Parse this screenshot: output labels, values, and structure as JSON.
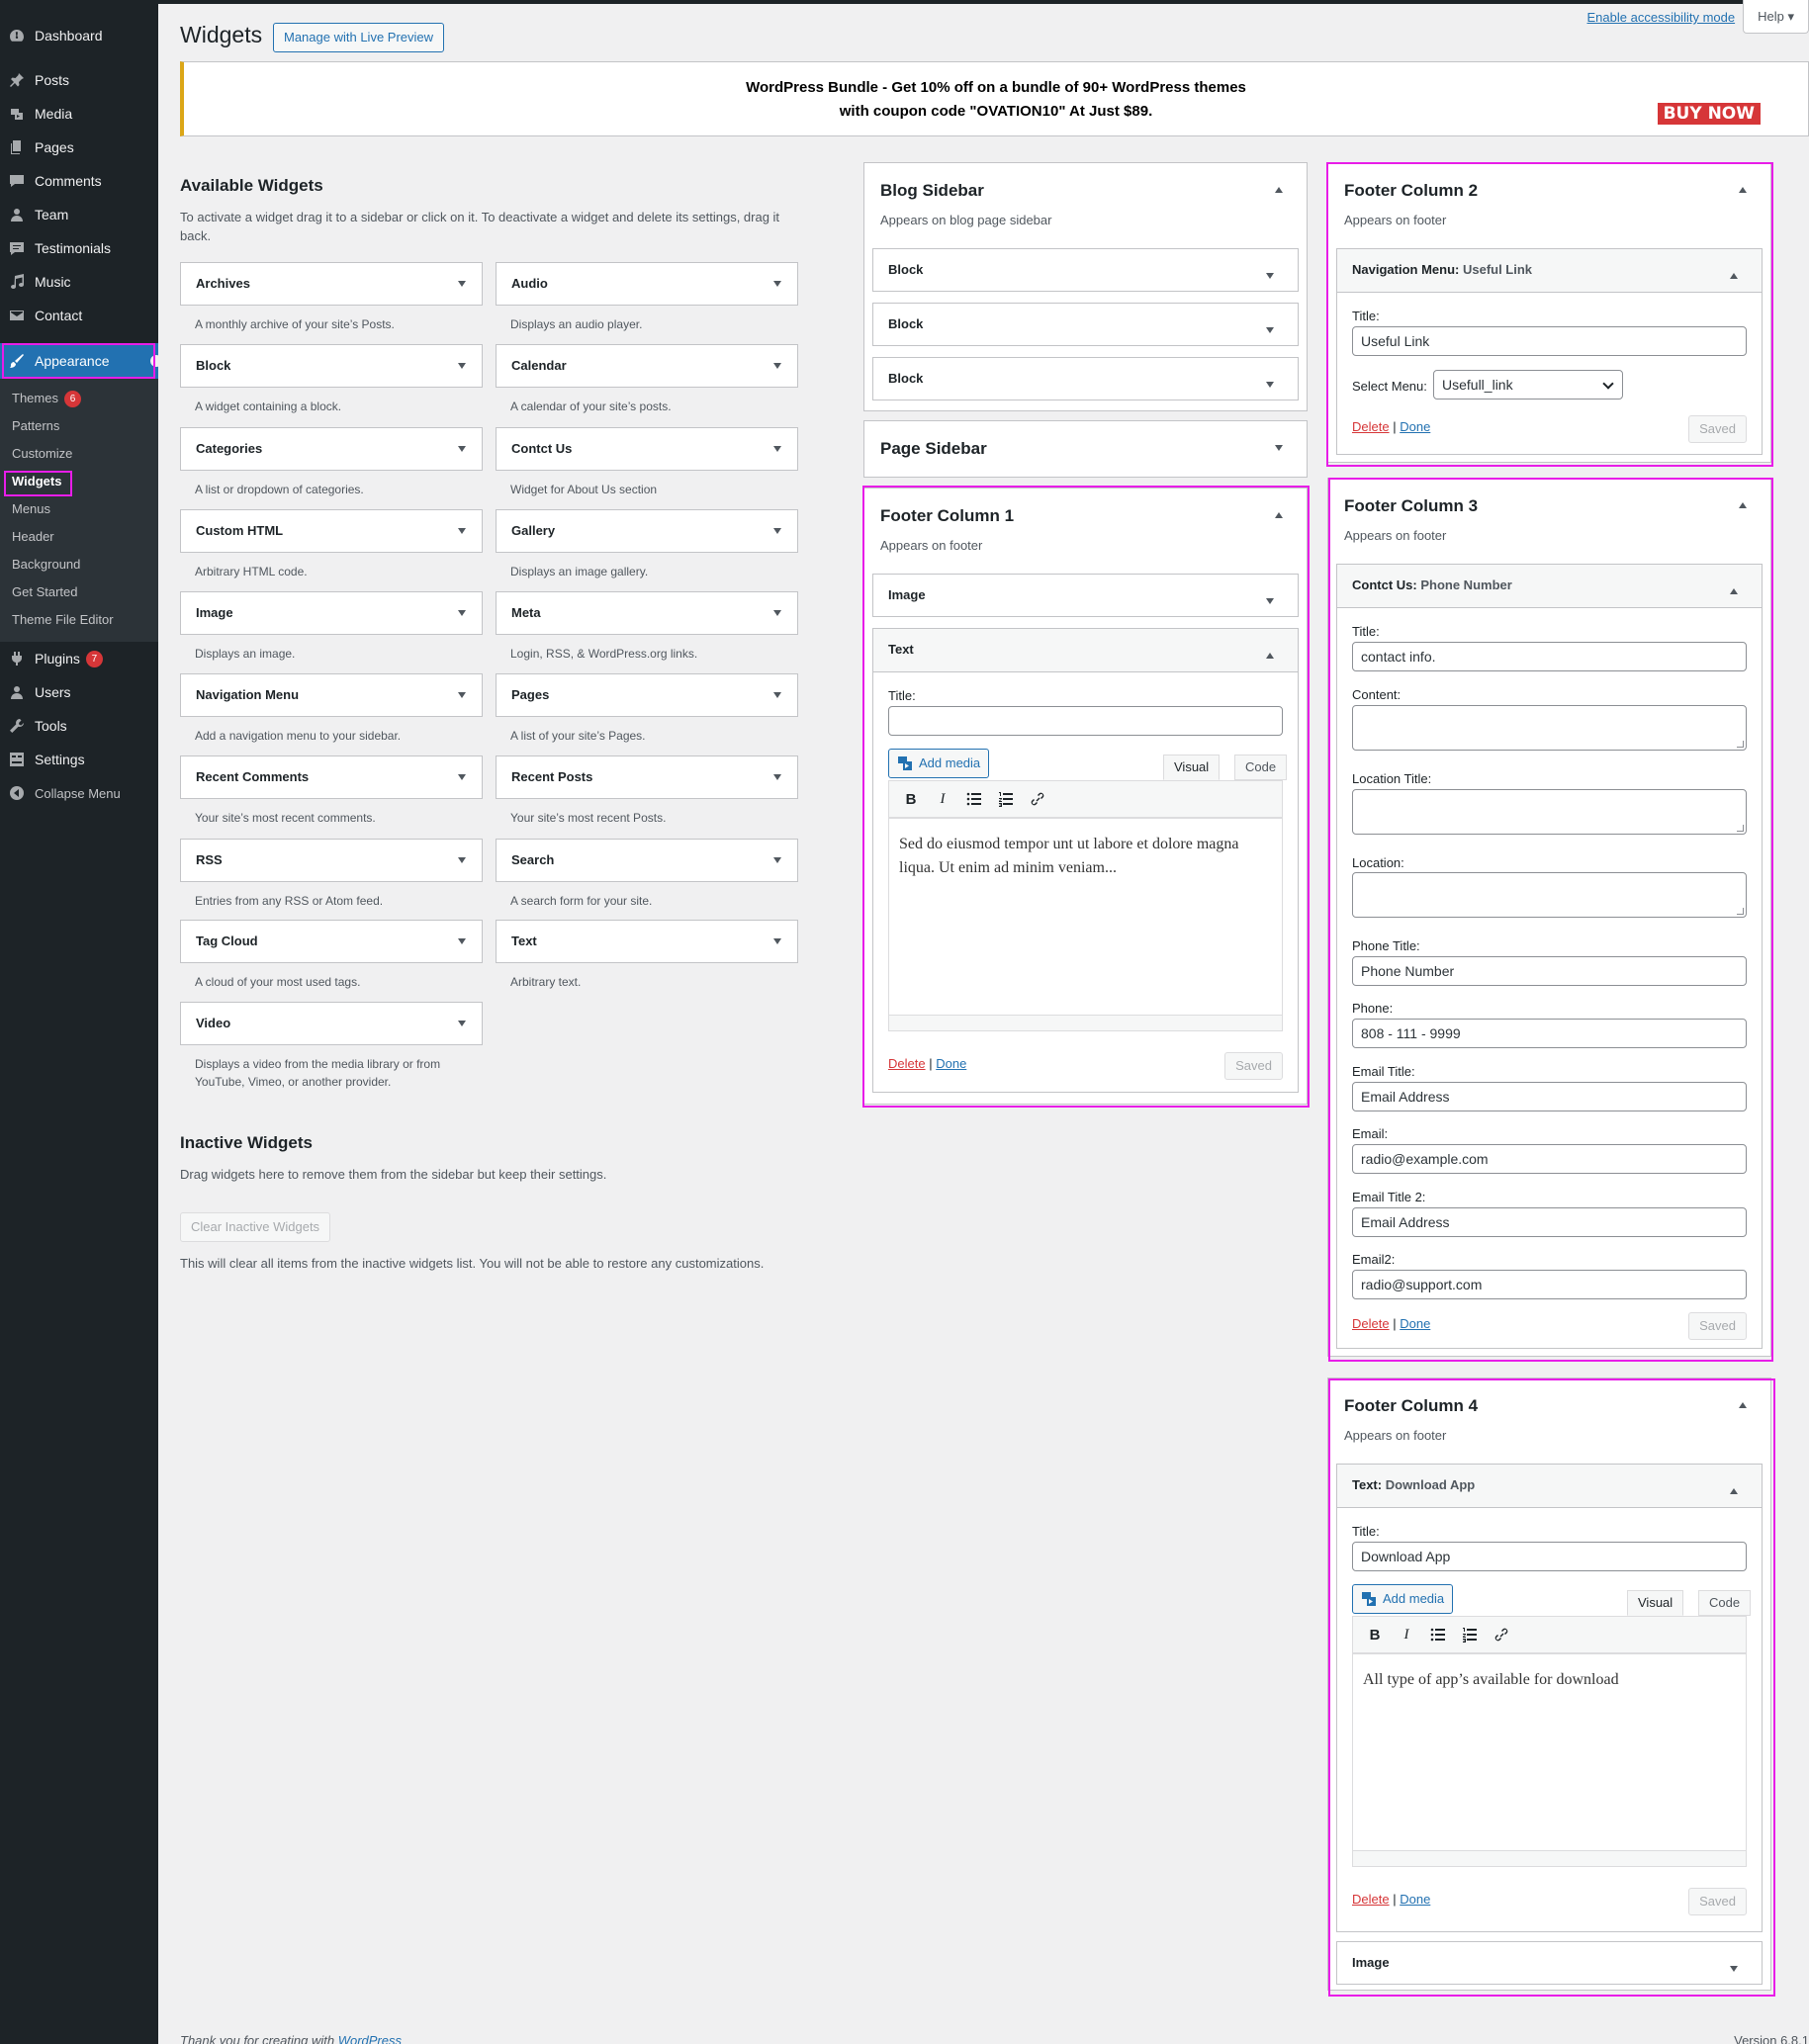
{
  "sidebar": {
    "items": [
      {
        "label": "Dashboard",
        "icon": "dashboard-icon"
      },
      {
        "label": "Posts",
        "icon": "pin-icon"
      },
      {
        "label": "Media",
        "icon": "media-icon"
      },
      {
        "label": "Pages",
        "icon": "pages-icon"
      },
      {
        "label": "Comments",
        "icon": "comment-icon"
      },
      {
        "label": "Team",
        "icon": "person-icon"
      },
      {
        "label": "Testimonials",
        "icon": "testimonial-icon"
      },
      {
        "label": "Music",
        "icon": "music-icon"
      },
      {
        "label": "Contact",
        "icon": "mail-icon"
      },
      {
        "label": "Appearance",
        "icon": "brush-icon"
      },
      {
        "label": "Plugins",
        "icon": "plugin-icon",
        "badge": "7"
      },
      {
        "label": "Users",
        "icon": "person-icon"
      },
      {
        "label": "Tools",
        "icon": "wrench-icon"
      },
      {
        "label": "Settings",
        "icon": "settings-icon"
      },
      {
        "label": "Collapse Menu",
        "icon": "collapse-icon"
      }
    ],
    "appearance_sub": [
      {
        "label": "Themes",
        "badge": "6"
      },
      {
        "label": "Patterns"
      },
      {
        "label": "Customize"
      },
      {
        "label": "Widgets"
      },
      {
        "label": "Menus"
      },
      {
        "label": "Header"
      },
      {
        "label": "Background"
      },
      {
        "label": "Get Started"
      },
      {
        "label": "Theme File Editor"
      }
    ]
  },
  "header": {
    "title": "Widgets",
    "live_preview": "Manage with Live Preview",
    "accessibility": "Enable accessibility mode",
    "help": "Help"
  },
  "notice": {
    "line1": "WordPress Bundle - Get 10% off on a bundle of 90+ WordPress themes",
    "line2": "with coupon code \"OVATION10\" At Just $89.",
    "buy": "BUY NOW"
  },
  "available": {
    "title": "Available Widgets",
    "desc": "To activate a widget drag it to a sidebar or click on it. To deactivate a widget and delete its settings, drag it back.",
    "widgets": [
      {
        "name": "Archives",
        "desc": "A monthly archive of your site’s Posts."
      },
      {
        "name": "Audio",
        "desc": "Displays an audio player."
      },
      {
        "name": "Block",
        "desc": "A widget containing a block."
      },
      {
        "name": "Calendar",
        "desc": "A calendar of your site’s posts."
      },
      {
        "name": "Categories",
        "desc": "A list or dropdown of categories."
      },
      {
        "name": "Contct Us",
        "desc": "Widget for About Us section"
      },
      {
        "name": "Custom HTML",
        "desc": "Arbitrary HTML code."
      },
      {
        "name": "Gallery",
        "desc": "Displays an image gallery."
      },
      {
        "name": "Image",
        "desc": "Displays an image."
      },
      {
        "name": "Meta",
        "desc": "Login, RSS, & WordPress.org links."
      },
      {
        "name": "Navigation Menu",
        "desc": "Add a navigation menu to your sidebar."
      },
      {
        "name": "Pages",
        "desc": "A list of your site’s Pages."
      },
      {
        "name": "Recent Comments",
        "desc": "Your site’s most recent comments."
      },
      {
        "name": "Recent Posts",
        "desc": "Your site’s most recent Posts."
      },
      {
        "name": "RSS",
        "desc": "Entries from any RSS or Atom feed."
      },
      {
        "name": "Search",
        "desc": "A search form for your site."
      },
      {
        "name": "Tag Cloud",
        "desc": "A cloud of your most used tags."
      },
      {
        "name": "Text",
        "desc": "Arbitrary text."
      },
      {
        "name": "Video",
        "desc": "Displays a video from the media library or from YouTube, Vimeo, or another provider."
      }
    ]
  },
  "inactive": {
    "title": "Inactive Widgets",
    "desc": "Drag widgets here to remove them from the sidebar but keep their settings.",
    "clear": "Clear Inactive Widgets",
    "note": "This will clear all items from the inactive widgets list. You will not be able to restore any customizations."
  },
  "blog_sidebar": {
    "title": "Blog Sidebar",
    "desc": "Appears on blog page sidebar",
    "widgets": [
      "Block",
      "Block",
      "Block"
    ]
  },
  "page_sidebar": {
    "title": "Page Sidebar"
  },
  "footer1": {
    "title": "Footer Column 1",
    "desc": "Appears on footer",
    "image_widget": "Image",
    "text_widget": "Text",
    "title_label": "Title:",
    "title_value": "",
    "add_media": "Add media",
    "tab_visual": "Visual",
    "tab_code": "Code",
    "content": "Sed do eiusmod tempor unt ut labore et dolore magna liqua. Ut enim ad minim veniam...",
    "delete": "Delete",
    "sep": "|",
    "done": "Done",
    "saved": "Saved"
  },
  "footer2": {
    "title": "Footer Column 2",
    "desc": "Appears on footer",
    "widget_type": "Navigation Menu:",
    "widget_name": "Useful Link",
    "title_label": "Title:",
    "title_value": "Useful Link",
    "menu_label": "Select Menu:",
    "menu_value": "Usefull_link",
    "delete": "Delete",
    "sep": "|",
    "done": "Done",
    "saved": "Saved"
  },
  "footer3": {
    "title": "Footer Column 3",
    "desc": "Appears on footer",
    "widget_type": "Contct Us:",
    "widget_name": "Phone Number",
    "labels": {
      "title": "Title:",
      "content": "Content:",
      "location_title": "Location Title:",
      "location": "Location:",
      "phone_title": "Phone Title:",
      "phone": "Phone:",
      "email_title": "Email Title:",
      "email": "Email:",
      "email_title2": "Email Title 2:",
      "email2": "Email2:"
    },
    "values": {
      "title": "contact info.",
      "phone_title": "Phone Number",
      "phone": "808 - 111 - 9999",
      "email_title": "Email Address",
      "email": "radio@example.com",
      "email_title2": "Email Address",
      "email2": "radio@support.com"
    },
    "delete": "Delete",
    "sep": "|",
    "done": "Done",
    "saved": "Saved"
  },
  "footer4": {
    "title": "Footer Column 4",
    "desc": "Appears on footer",
    "widget_type": "Text:",
    "widget_name": "Download App",
    "title_label": "Title:",
    "title_value": "Download App",
    "add_media": "Add media",
    "tab_visual": "Visual",
    "tab_code": "Code",
    "content": "All type of app’s available for download",
    "delete": "Delete",
    "sep": "|",
    "done": "Done",
    "saved": "Saved",
    "image_widget": "Image"
  },
  "footer": {
    "thanks": "Thank you for creating with",
    "wp": "WordPress",
    "version": "Version 6.8.1"
  },
  "colors": {
    "admin_bar": "#1d2327",
    "accent": "#2271b1",
    "highlight": "#e81de8",
    "badge": "#d63638"
  }
}
